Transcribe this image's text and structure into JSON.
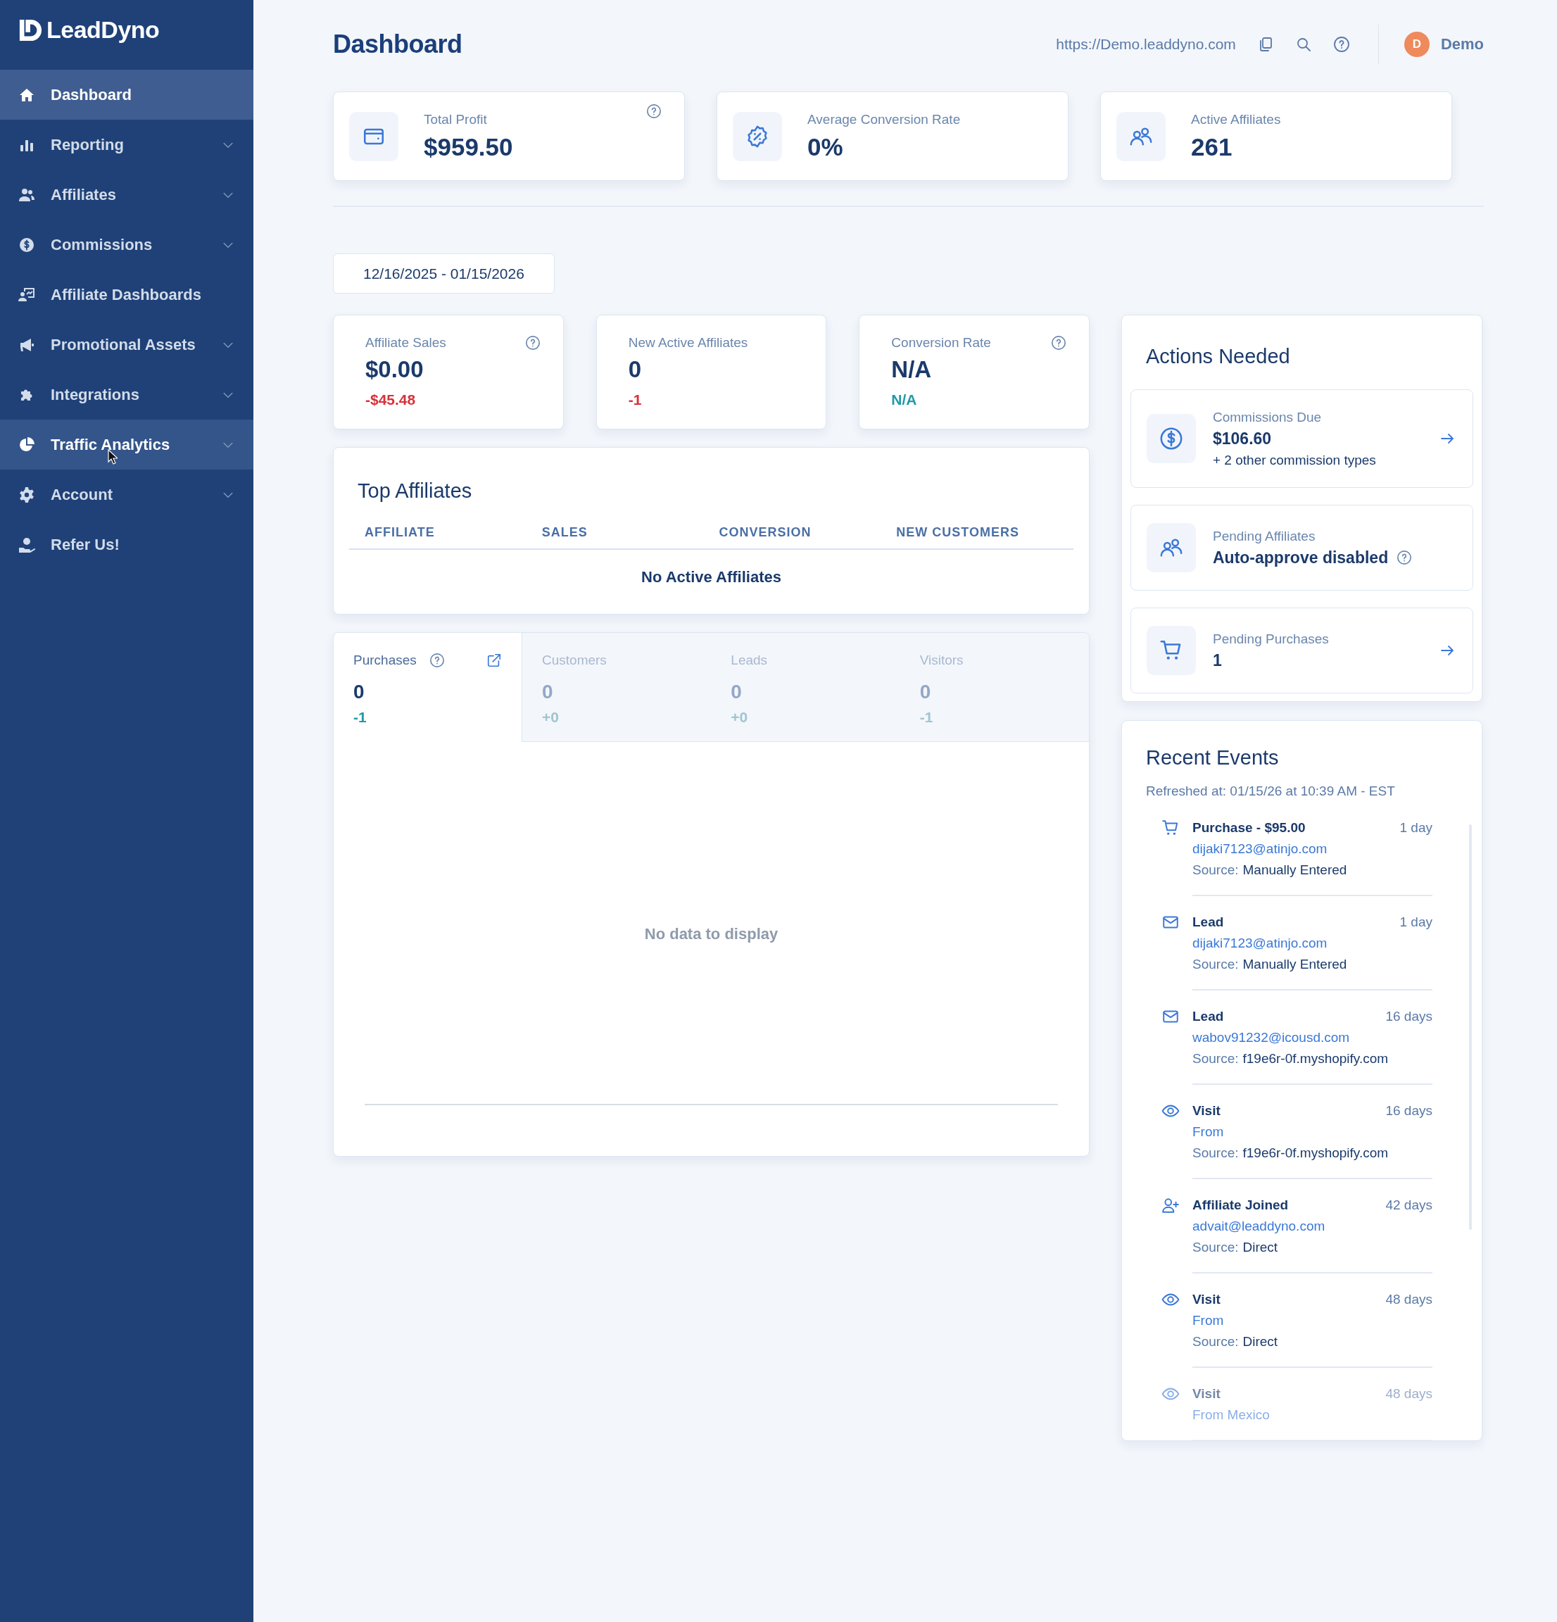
{
  "sidebar": {
    "logo": "LeadDyno",
    "items": [
      {
        "label": "Dashboard",
        "selected": true,
        "hovered": false,
        "expandable": false
      },
      {
        "label": "Reporting",
        "selected": false,
        "hovered": false,
        "expandable": true
      },
      {
        "label": "Affiliates",
        "selected": false,
        "hovered": false,
        "expandable": true
      },
      {
        "label": "Commissions",
        "selected": false,
        "hovered": false,
        "expandable": true
      },
      {
        "label": "Affiliate Dashboards",
        "selected": false,
        "hovered": false,
        "expandable": false
      },
      {
        "label": "Promotional Assets",
        "selected": false,
        "hovered": false,
        "expandable": true
      },
      {
        "label": "Integrations",
        "selected": false,
        "hovered": false,
        "expandable": true
      },
      {
        "label": "Traffic Analytics",
        "selected": false,
        "hovered": true,
        "expandable": true
      },
      {
        "label": "Account",
        "selected": false,
        "hovered": false,
        "expandable": true
      },
      {
        "label": "Refer Us!",
        "selected": false,
        "hovered": false,
        "expandable": false
      }
    ]
  },
  "header": {
    "title": "Dashboard",
    "url": "https://Demo.leaddyno.com",
    "user": {
      "initial": "D",
      "name": "Demo"
    }
  },
  "stat_cards": [
    {
      "label": "Total Profit",
      "value": "$959.50",
      "help": true
    },
    {
      "label": "Average Conversion Rate",
      "value": "0%",
      "help": false
    },
    {
      "label": "Active Affiliates",
      "value": "261",
      "help": false
    }
  ],
  "date_range": "12/16/2025 - 01/15/2026",
  "metric_cards": [
    {
      "label": "Affiliate Sales",
      "value": "$0.00",
      "delta": "-$45.48",
      "color": "#d6313a",
      "help": true
    },
    {
      "label": "New Active Affiliates",
      "value": "0",
      "delta": "-1",
      "color": "#d6313a",
      "help": false
    },
    {
      "label": "Conversion Rate",
      "value": "N/A",
      "delta": "N/A",
      "color": "#1f9aa6",
      "help": true
    }
  ],
  "top_affiliates": {
    "title": "Top Affiliates",
    "columns": [
      "AFFILIATE",
      "SALES",
      "CONVERSION",
      "NEW CUSTOMERS"
    ],
    "empty": "No Active Affiliates"
  },
  "activity": {
    "tabs": [
      {
        "label": "Purchases",
        "value": "0",
        "delta": "-1",
        "selected": true,
        "help": true,
        "external_link": true
      },
      {
        "label": "Customers",
        "value": "0",
        "delta": "+0",
        "selected": false,
        "help": false,
        "external_link": false
      },
      {
        "label": "Leads",
        "value": "0",
        "delta": "+0",
        "selected": false,
        "help": false,
        "external_link": false
      },
      {
        "label": "Visitors",
        "value": "0",
        "delta": "-1",
        "selected": false,
        "help": false,
        "external_link": false
      }
    ],
    "empty": "No data to display"
  },
  "actions_needed": {
    "title": "Actions Needed",
    "items": [
      {
        "label": "Commissions Due",
        "value": "$106.60",
        "note": "+ 2 other commission types",
        "arrow": true,
        "help": false
      },
      {
        "label": "Pending Affiliates",
        "value": "Auto-approve disabled",
        "arrow": false,
        "help": true
      },
      {
        "label": "Pending Purchases",
        "value": "1",
        "arrow": true,
        "help": false
      }
    ]
  },
  "recent_events": {
    "title": "Recent Events",
    "refreshed": "Refreshed at: 01/15/26 at 10:39 AM - EST",
    "events": [
      {
        "kind": "purchase",
        "title": "Purchase - $95.00",
        "time": "1 day",
        "detail": "dijaki7123@atinjo.com",
        "source_label": "Source:",
        "source": "Manually Entered",
        "faded": false
      },
      {
        "kind": "lead",
        "title": "Lead",
        "time": "1 day",
        "detail": "dijaki7123@atinjo.com",
        "source_label": "Source:",
        "source": "Manually Entered",
        "faded": false
      },
      {
        "kind": "lead",
        "title": "Lead",
        "time": "16 days",
        "detail": "wabov91232@icousd.com",
        "source_label": "Source:",
        "source": "f19e6r-0f.myshopify.com",
        "faded": false
      },
      {
        "kind": "visit",
        "title": "Visit",
        "time": "16 days",
        "detail": "From",
        "source_label": "Source:",
        "source": "f19e6r-0f.myshopify.com",
        "faded": false
      },
      {
        "kind": "affiliate_joined",
        "title": "Affiliate Joined",
        "time": "42 days",
        "detail": "advait@leaddyno.com",
        "source_label": "Source:",
        "source": "Direct",
        "faded": false
      },
      {
        "kind": "visit",
        "title": "Visit",
        "time": "48 days",
        "detail": "From",
        "source_label": "Source:",
        "source": "Direct",
        "faded": false
      },
      {
        "kind": "visit",
        "title": "Visit",
        "time": "48 days",
        "detail": "From Mexico",
        "faded": true
      }
    ]
  }
}
